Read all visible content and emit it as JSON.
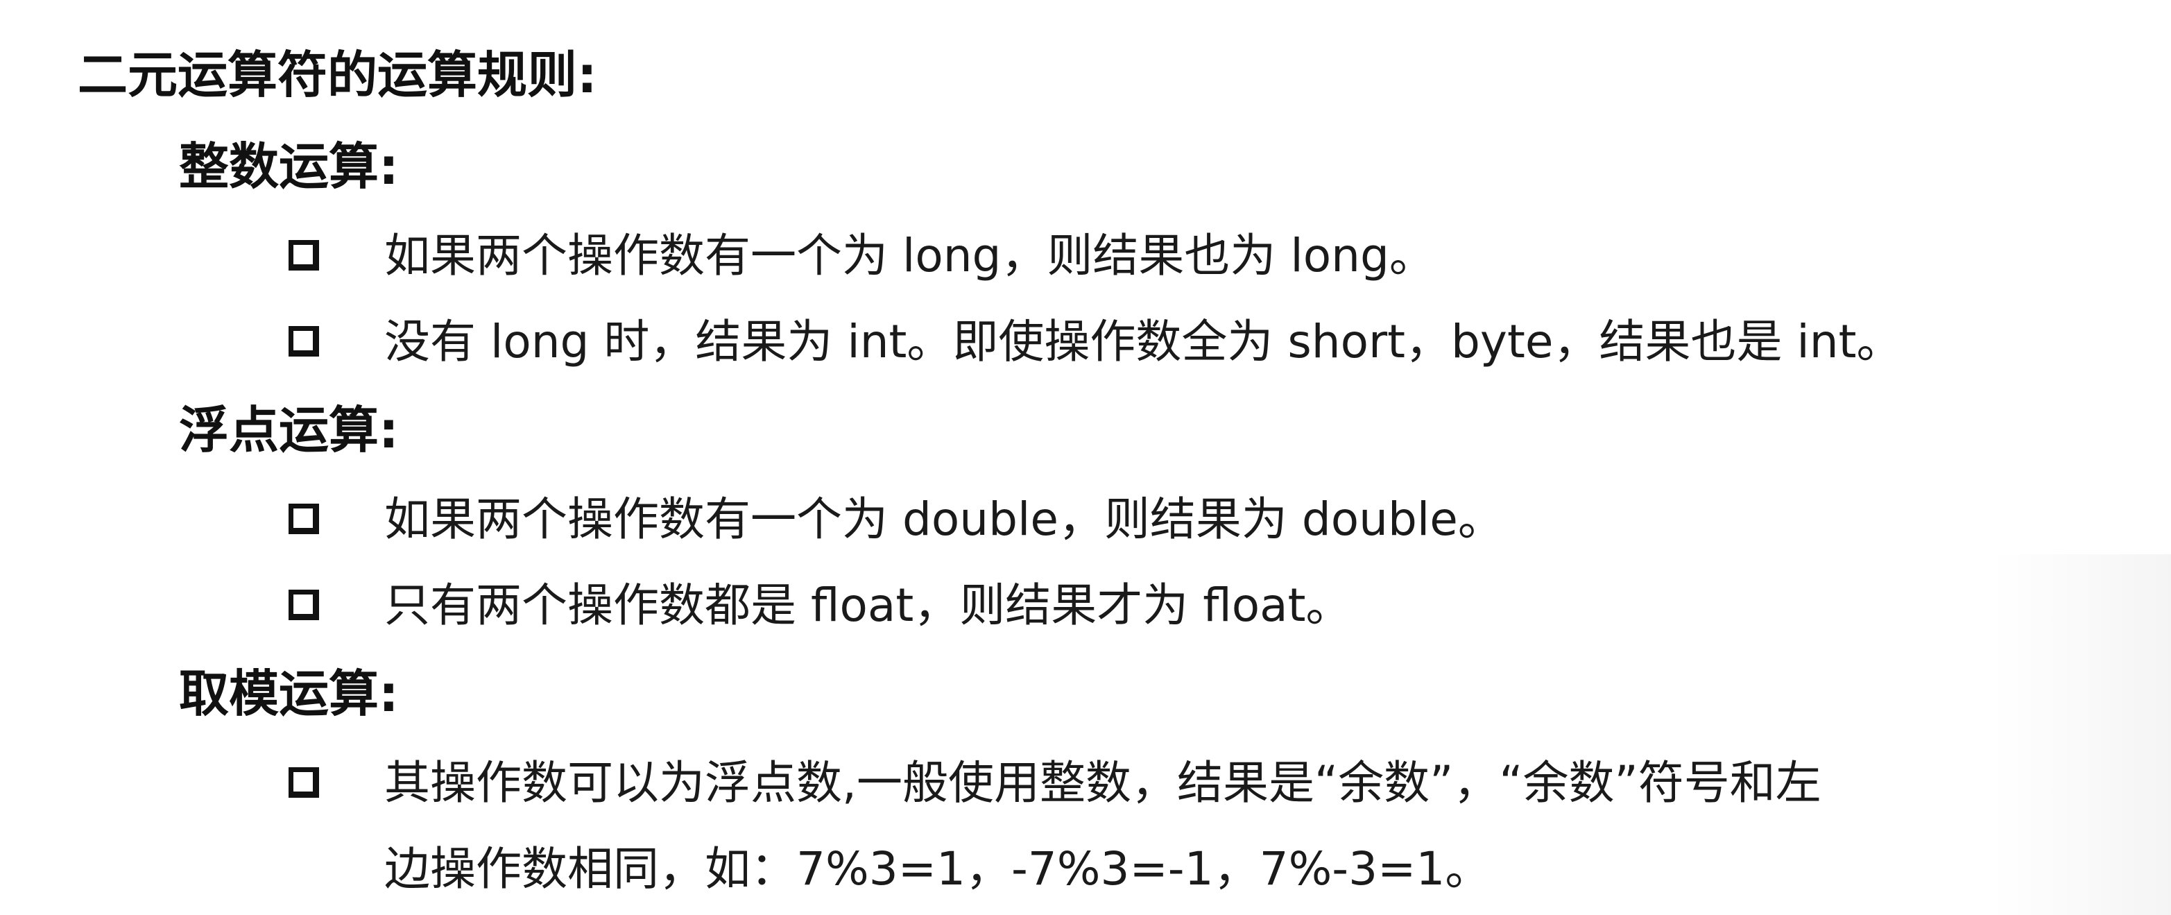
{
  "title": "二元运算符的运算规则:",
  "sections": [
    {
      "heading": "整数运算:",
      "items": [
        "如果两个操作数有一个为 long，则结果也为 long。",
        "没有 long 时，结果为 int。即使操作数全为 short，byte，结果也是 int。"
      ]
    },
    {
      "heading": "浮点运算:",
      "items": [
        "如果两个操作数有一个为 double，则结果为 double。",
        "只有两个操作数都是 float，则结果才为 float。"
      ]
    },
    {
      "heading": "取模运算:",
      "items": [
        "其操作数可以为浮点数,一般使用整数，结果是“余数”，“余数”符号和左",
        "边操作数相同，如：7%3=1，-7%3=-1，7%-3=1。"
      ]
    }
  ],
  "icons": {
    "bullet": "checkbox-square-icon"
  }
}
